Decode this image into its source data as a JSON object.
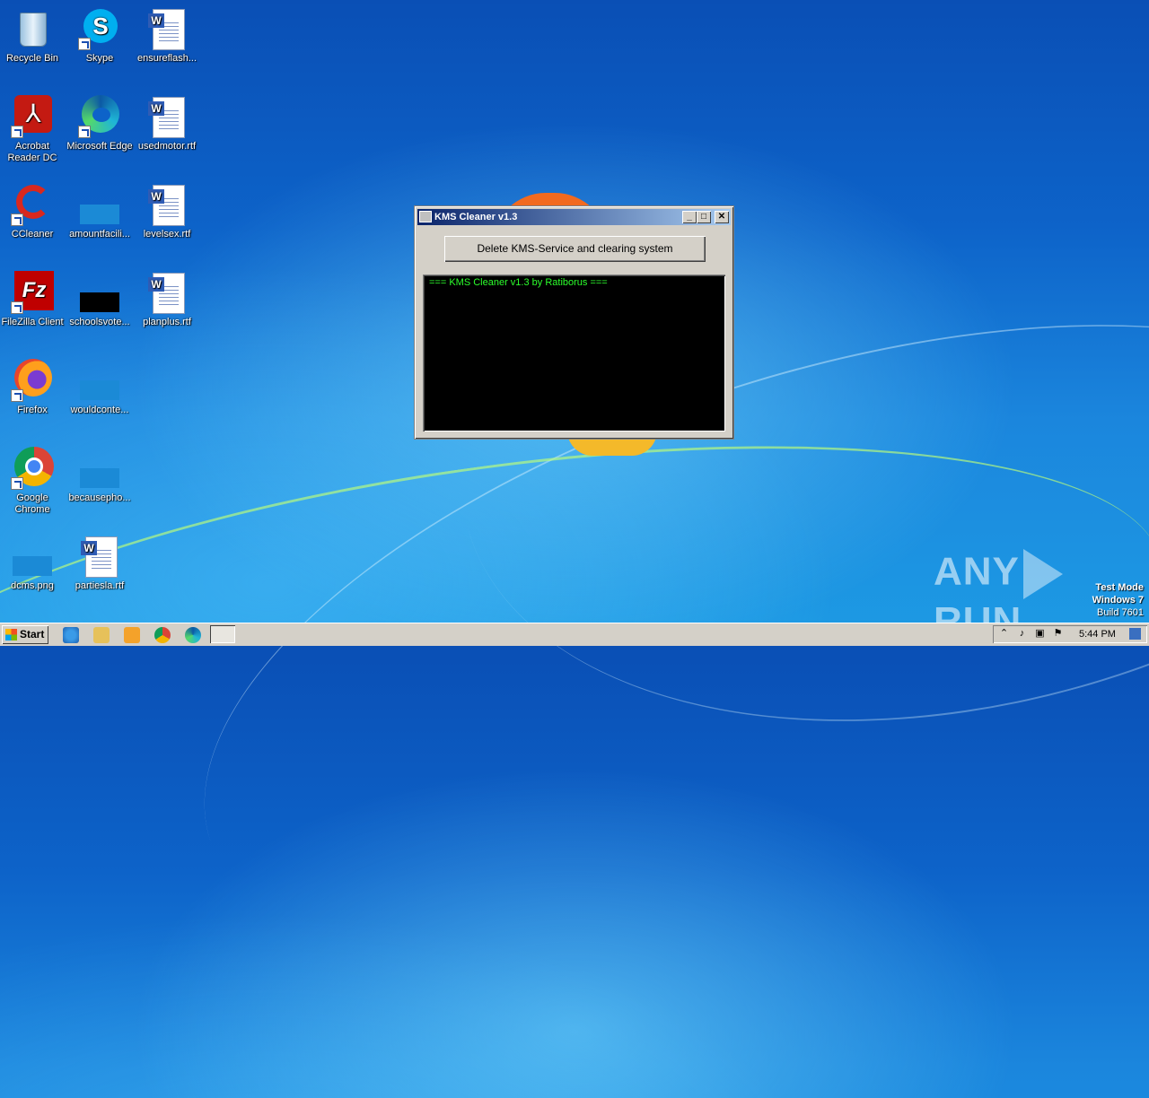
{
  "desktop": {
    "icons": [
      {
        "label": "Recycle Bin",
        "icon": "recycle-bin-icon"
      },
      {
        "label": "Skype",
        "icon": "skype-icon"
      },
      {
        "label": "ensureflash...",
        "icon": "word-document-icon"
      },
      {
        "label": "Acrobat Reader DC",
        "icon": "acrobat-icon"
      },
      {
        "label": "Microsoft Edge",
        "icon": "edge-icon"
      },
      {
        "label": "usedmotor.rtf",
        "icon": "word-document-icon"
      },
      {
        "label": "CCleaner",
        "icon": "ccleaner-icon"
      },
      {
        "label": "amountfacili...",
        "icon": "image-file-icon"
      },
      {
        "label": "levelsex.rtf",
        "icon": "word-document-icon"
      },
      {
        "label": "FileZilla Client",
        "icon": "filezilla-icon"
      },
      {
        "label": "schoolsvote...",
        "icon": "image-file-icon"
      },
      {
        "label": "planplus.rtf",
        "icon": "word-document-icon"
      },
      {
        "label": "Firefox",
        "icon": "firefox-icon"
      },
      {
        "label": "wouldconte...",
        "icon": "image-file-icon"
      },
      {
        "label": "Google Chrome",
        "icon": "chrome-icon"
      },
      {
        "label": "becausepho...",
        "icon": "image-file-icon"
      },
      {
        "label": "dcms.png",
        "icon": "image-file-icon"
      },
      {
        "label": "partiesla.rtf",
        "icon": "word-document-icon"
      }
    ]
  },
  "window": {
    "title": "KMS Cleaner v1.3",
    "button_label": "Delete KMS-Service and clearing system",
    "console_line": "=== KMS Cleaner v1.3 by Ratiborus ===",
    "minimize": "_",
    "maximize": "□",
    "close": "✕"
  },
  "watermark": {
    "text_left": "ANY",
    "text_right": "RUN"
  },
  "testmode": {
    "line1": "Test Mode",
    "line2": "Windows 7",
    "line3": "Build 7601"
  },
  "taskbar": {
    "start_label": "Start",
    "clock": "5:44 PM"
  }
}
